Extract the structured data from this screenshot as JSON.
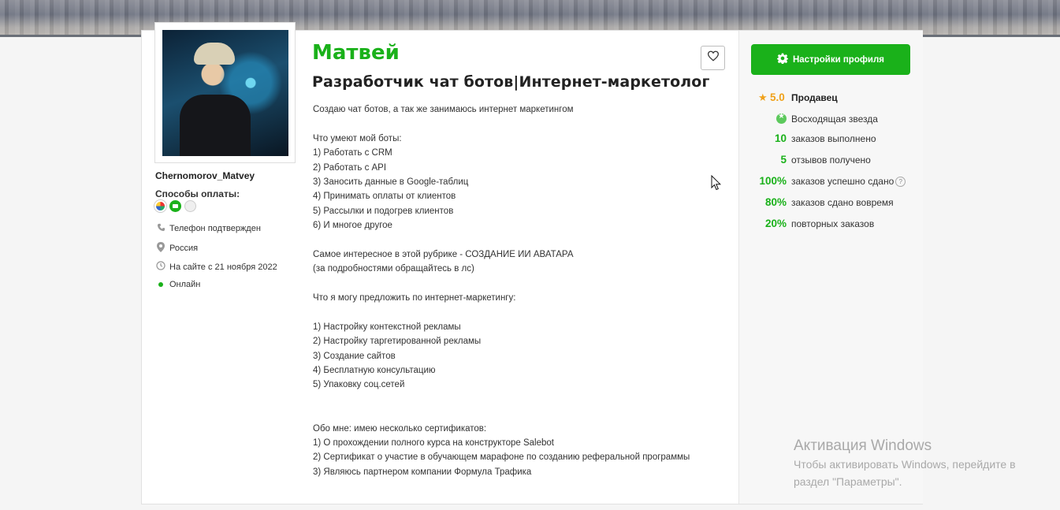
{
  "profile": {
    "name": "Матвей",
    "headline": "Разработчик чат ботов|Интернет-маркетолог",
    "username": "Chernomorov_Matvey",
    "payment_label": "Способы оплаты:",
    "payment_icons": [
      "card-payment-icon",
      "wallet-payment-icon",
      "other-payment-icon"
    ],
    "info": {
      "phone": "Телефон подтвержден",
      "country": "Россия",
      "since": "На сайте с 21 ноября 2022",
      "status": "Онлайн"
    },
    "description": [
      "Создаю чат ботов, а так же занимаюсь интернет маркетингом",
      "",
      "Что умеют мой боты:",
      "1) Работать с CRM",
      "2) Работать с API",
      "3) Заносить данные в Google-таблиц",
      "4) Принимать оплаты от клиентов",
      "5) Рассылки и подогрев клиентов",
      "6) И многое другое",
      "",
      "Самое интересное в этой рубрике - СОЗДАНИЕ ИИ АВАТАРА",
      "(за подробностями обращайтесь в лс)",
      "",
      "Что я могу предложить по интернет-маркетингу:",
      "",
      "1) Настройку контекстной рекламы",
      "2) Настройку таргетированной рекламы",
      "3) Создание сайтов",
      "4) Бесплатную консультацию",
      "5) Упаковку соц.сетей",
      "",
      "",
      "Обо мне: имею несколько сертификатов:",
      "1) О прохождении полного курса на конструкторе Salebot",
      "2) Сертификат о участие в обучающем марафоне по созданию реферальной программы",
      "3) Являюсь партнером компании Формула Трафика"
    ]
  },
  "sidebar": {
    "settings_button": "Настройки профиля",
    "rating": "5.0",
    "rating_label": "Продавец",
    "badge": "Восходящая звезда",
    "stats": [
      {
        "value": "10",
        "label": "заказов выполнено"
      },
      {
        "value": "5",
        "label": "отзывов получено"
      },
      {
        "value": "100%",
        "label": "заказов успешно сдано"
      },
      {
        "value": "80%",
        "label": "заказов сдано вовремя"
      },
      {
        "value": "20%",
        "label": "повторных заказов"
      }
    ],
    "help_glyph": "?"
  },
  "watermark": {
    "title": "Активация Windows",
    "line1": "Чтобы активировать Windows, перейдите в",
    "line2": "раздел \"Параметры\"."
  },
  "colors": {
    "accent": "#1ab11a",
    "star": "#f0a11a"
  }
}
